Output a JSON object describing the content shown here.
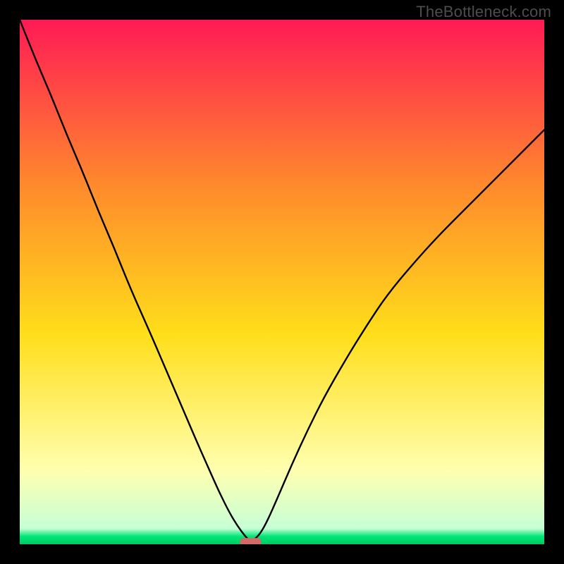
{
  "watermark": "TheBottleneck.com",
  "chart_data": {
    "type": "line",
    "title": "",
    "xlabel": "",
    "ylabel": "",
    "xlim": [
      0,
      100
    ],
    "ylim": [
      0,
      100
    ],
    "gradient_colors": {
      "top": "#ff1a55",
      "upper_mid": "#ff8b2c",
      "mid": "#ffde1a",
      "lower_mid": "#ffffb0",
      "bottom_strip": "#00e676",
      "bottom_edge": "#00c864"
    },
    "curve": {
      "description": "V-shaped bottleneck curve; apex at x≈44% touching green baseline, rising steeply toward upper-left corner and curving more gently toward upper-right edge (reaching ~80% height at x=100%).",
      "x": [
        0.0,
        3.0,
        6.0,
        9.0,
        12.0,
        15.0,
        18.0,
        21.0,
        25.0,
        28.0,
        31.0,
        34.0,
        36.0,
        38.0,
        40.0,
        41.5,
        43.0,
        44.0,
        45.5,
        47.0,
        49.0,
        52.0,
        55.0,
        58.0,
        62.0,
        66.0,
        70.0,
        75.0,
        80.0,
        86.0,
        93.0,
        100.0
      ],
      "y": [
        100.0,
        92.5,
        85.5,
        78.0,
        71.0,
        63.5,
        56.5,
        49.0,
        40.0,
        33.0,
        26.0,
        19.0,
        14.5,
        10.0,
        6.0,
        3.5,
        1.5,
        0.5,
        1.5,
        4.0,
        8.5,
        15.5,
        22.0,
        28.0,
        35.0,
        41.5,
        47.5,
        53.5,
        59.0,
        65.0,
        72.0,
        79.0
      ]
    },
    "marker": {
      "x": 44.0,
      "y": 0.4,
      "width_pct": 4.0,
      "height_pct": 1.6,
      "color": "#d36a6a"
    }
  }
}
